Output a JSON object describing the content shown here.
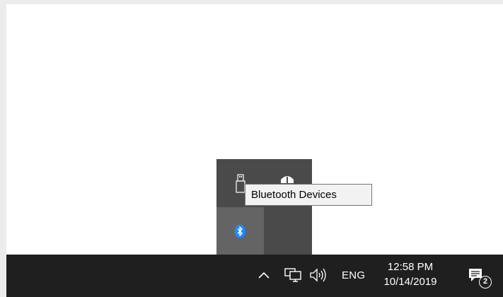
{
  "tooltip": {
    "text": "Bluetooth Devices"
  },
  "tray_overflow": {
    "icons": [
      "usb-drive-icon",
      "network-drive-icon",
      "bluetooth-icon"
    ]
  },
  "taskbar": {
    "language": "ENG",
    "time": "12:58 PM",
    "date": "10/14/2019",
    "notification_count": "2",
    "icons": [
      "chevron-up-icon",
      "network-icon",
      "volume-icon",
      "action-center-icon"
    ]
  },
  "colors": {
    "taskbar": "#1f1f1f",
    "overflow_panel": "#4a4a4a",
    "selected_cell": "#646464",
    "bluetooth_accent": "#1a8cff",
    "desktop": "#ffffff"
  }
}
